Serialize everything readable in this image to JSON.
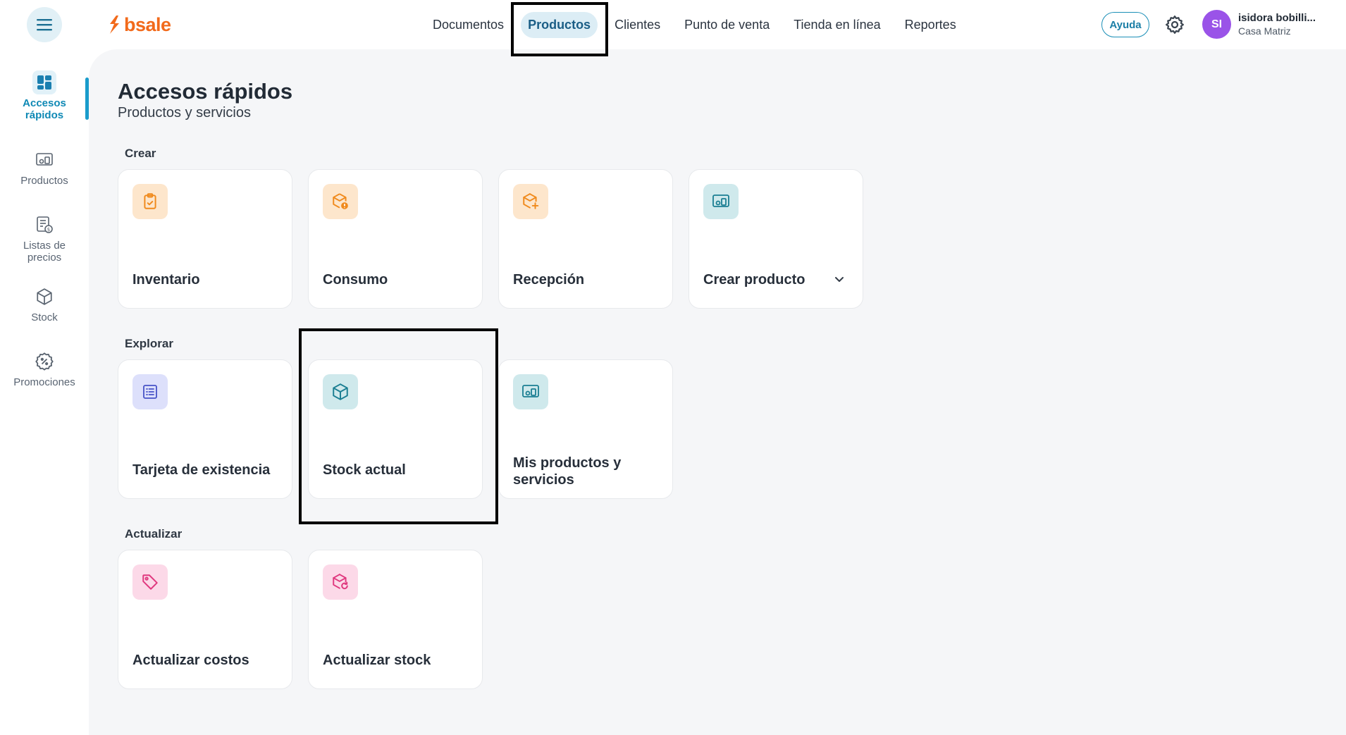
{
  "header": {
    "logo_text": "bsale",
    "nav": [
      "Documentos",
      "Productos",
      "Clientes",
      "Punto de venta",
      "Tienda en línea",
      "Reportes"
    ],
    "active_nav": "Productos",
    "help_label": "Ayuda",
    "user": {
      "initials": "SI",
      "name": "isidora bobilli...",
      "branch": "Casa Matriz"
    }
  },
  "sidebar": {
    "items": [
      {
        "label": "Accesos rápidos",
        "icon": "dashboard-icon",
        "active": true
      },
      {
        "label": "Productos",
        "icon": "products-icon",
        "active": false
      },
      {
        "label": "Listas de precios",
        "icon": "price-list-icon",
        "active": false
      },
      {
        "label": "Stock",
        "icon": "box-icon",
        "active": false
      },
      {
        "label": "Promociones",
        "icon": "discount-badge-icon",
        "active": false
      }
    ]
  },
  "page": {
    "title": "Accesos rápidos",
    "subtitle": "Productos y servicios"
  },
  "sections": {
    "crear": {
      "label": "Crear",
      "cards": [
        {
          "label": "Inventario",
          "icon": "clipboard-check-icon"
        },
        {
          "label": "Consumo",
          "icon": "box-alert-icon"
        },
        {
          "label": "Recepción",
          "icon": "box-plus-icon"
        },
        {
          "label": "Crear producto",
          "icon": "products-icon"
        }
      ]
    },
    "explorar": {
      "label": "Explorar",
      "cards": [
        {
          "label": "Tarjeta de existencia",
          "icon": "list-card-icon"
        },
        {
          "label": "Stock actual",
          "icon": "box-icon"
        },
        {
          "label": "Mis productos y servicios",
          "icon": "products-icon"
        }
      ]
    },
    "actualizar": {
      "label": "Actualizar",
      "cards": [
        {
          "label": "Actualizar costos",
          "icon": "tag-icon"
        },
        {
          "label": "Actualizar stock",
          "icon": "box-refresh-icon"
        }
      ]
    }
  },
  "colors": {
    "brand": "#f26a1b",
    "accent": "#1a9ccb",
    "orange_tile": "#fde6cc",
    "teal_tile": "#cfe9ec",
    "purple_tile": "#dde0fb",
    "pink_tile": "#fcd9e8"
  }
}
